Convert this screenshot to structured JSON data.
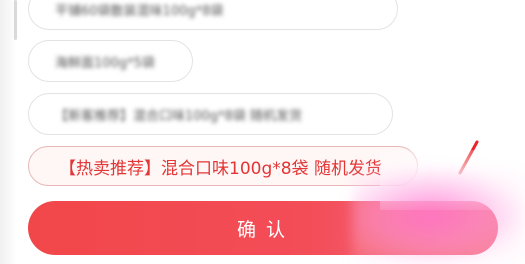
{
  "options": [
    {
      "label": "平铺60袋散装混味100g*8袋"
    },
    {
      "label": "海鲜面100g*5袋"
    },
    {
      "label": "【新客推荐】混合口味100g*8袋 随机发货"
    }
  ],
  "selected_option": {
    "label": "【热卖推荐】混合口味100g*8袋 随机发货"
  },
  "confirm_button": {
    "label": "确认"
  },
  "colors": {
    "accent": "#f2474a",
    "selected_bg": "#fff6f6",
    "selected_text": "#e33535"
  }
}
